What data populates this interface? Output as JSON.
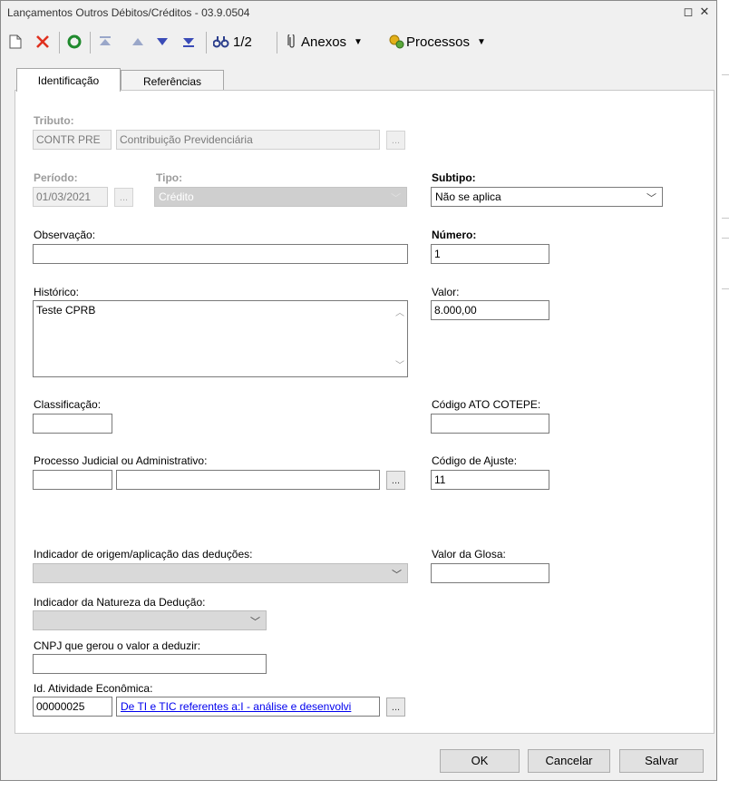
{
  "window": {
    "title": "Lançamentos Outros Débitos/Créditos - 03.9.0504"
  },
  "titlebar": {
    "restore_glyph": "◻",
    "close_glyph": "✕"
  },
  "toolbar": {
    "record_counter": "1/2",
    "anexos_label": "Anexos",
    "processos_label": "Processos",
    "icons": [
      "new-icon",
      "delete-icon",
      "refresh-icon",
      "first-icon",
      "prev-icon",
      "next-icon",
      "last-icon",
      "find-icon",
      "attach-icon",
      "process-icon"
    ]
  },
  "tabs": [
    {
      "label": "Identificação",
      "active": true
    },
    {
      "label": "Referências",
      "active": false
    }
  ],
  "form": {
    "tributo": {
      "label": "Tributo:",
      "code": "CONTR PRE",
      "description": "Contribuição Previdenciária"
    },
    "periodo": {
      "label": "Período:",
      "value": "01/03/2021"
    },
    "tipo": {
      "label": "Tipo:",
      "value": "Crédito"
    },
    "subtipo": {
      "label": "Subtipo:",
      "value": "Não se aplica"
    },
    "observacao": {
      "label": "Observação:",
      "value": ""
    },
    "numero": {
      "label": "Número:",
      "value": "1"
    },
    "historico": {
      "label": "Histórico:",
      "value": "Teste CPRB"
    },
    "valor": {
      "label": "Valor:",
      "value": "8.000,00"
    },
    "classificacao": {
      "label": "Classificação:",
      "value": ""
    },
    "codigo_ato_cotepe": {
      "label": "Código ATO COTEPE:",
      "value": ""
    },
    "processo": {
      "label": "Processo Judicial ou Administrativo:",
      "value1": "",
      "value2": ""
    },
    "codigo_ajuste": {
      "label": "Código de Ajuste:",
      "value": "11"
    },
    "indicador_origem": {
      "label": "Indicador de origem/aplicação das deduções:",
      "value": ""
    },
    "valor_glosa": {
      "label": "Valor da Glosa:",
      "value": ""
    },
    "indicador_natureza": {
      "label": "Indicador da Natureza da Dedução:",
      "value": ""
    },
    "cnpj": {
      "label": "CNPJ que gerou o valor a deduzir:",
      "value": ""
    },
    "atividade": {
      "label": "Id. Atividade Econômica:",
      "code": "00000025",
      "description": "De TI e TIC referentes a:I - análise e desenvolvi"
    }
  },
  "buttons": {
    "ok": "OK",
    "cancel": "Cancelar",
    "save": "Salvar",
    "ellipsis": "..."
  }
}
